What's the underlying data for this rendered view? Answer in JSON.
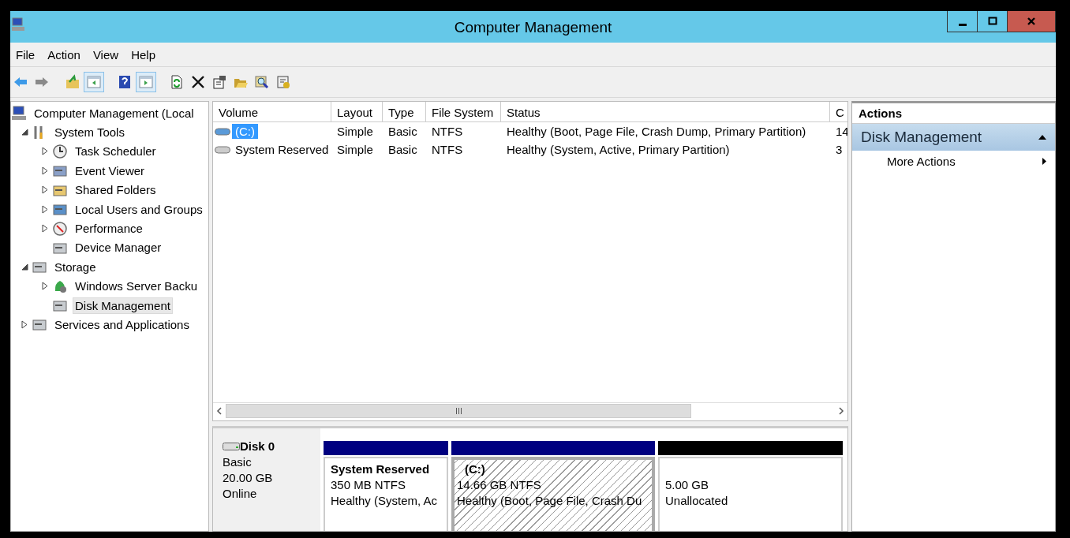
{
  "window": {
    "title": "Computer Management"
  },
  "menu": [
    "File",
    "Action",
    "View",
    "Help"
  ],
  "toolbar": [
    {
      "pressed": false
    },
    {
      "pressed": false
    },
    {
      "pressed": false
    },
    {
      "pressed": true
    },
    {
      "pressed": false
    },
    {
      "pressed": true
    },
    {
      "pressed": false
    },
    {
      "pressed": false
    },
    {
      "pressed": false
    },
    {
      "pressed": false
    },
    {
      "pressed": false
    },
    {
      "pressed": false
    }
  ],
  "tree": [
    {
      "label": "Computer Management (Local",
      "selected": false,
      "children": [
        {
          "label": "System Tools",
          "expanded": true,
          "selected": false,
          "children": [
            {
              "label": "Task Scheduler",
              "expanded": false,
              "selected": false
            },
            {
              "label": "Event Viewer",
              "expanded": false,
              "selected": false
            },
            {
              "label": "Shared Folders",
              "expanded": false,
              "selected": false
            },
            {
              "label": "Local Users and Groups",
              "expanded": false,
              "selected": false
            },
            {
              "label": "Performance",
              "expanded": false,
              "selected": false
            },
            {
              "label": "Device Manager",
              "selected": false
            }
          ]
        },
        {
          "label": "Storage",
          "expanded": true,
          "selected": false,
          "children": [
            {
              "label": "Windows Server Backu",
              "expanded": false,
              "selected": false
            },
            {
              "label": "Disk Management",
              "selected": true
            }
          ]
        },
        {
          "label": "Services and Applications",
          "expanded": false,
          "selected": false
        }
      ]
    }
  ],
  "table": {
    "columns": [
      "Volume",
      "Layout",
      "Type",
      "File System",
      "Status",
      "C"
    ],
    "rows": [
      {
        "cells": [
          "(C:)",
          "Simple",
          "Basic",
          "NTFS",
          "Healthy (Boot, Page File, Crash Dump, Primary Partition)",
          "14"
        ],
        "selected": true
      },
      {
        "cells": [
          "System Reserved",
          "Simple",
          "Basic",
          "NTFS",
          "Healthy (System, Active, Primary Partition)",
          "3"
        ],
        "selected": false
      }
    ]
  },
  "disk": {
    "name": "Disk 0",
    "type": "Basic",
    "size": "20.00 GB",
    "state": "Online",
    "partitions": [
      {
        "name": "System Reserved",
        "size": "350 MB NTFS",
        "status": "Healthy (System, Ac",
        "color": "#000080",
        "selected": false
      },
      {
        "name": "(C:)",
        "size": "14.66 GB NTFS",
        "status": "Healthy (Boot, Page File, Crash Du",
        "color": "#000080",
        "selected": true
      },
      {
        "size": "5.00 GB",
        "status": "Unallocated",
        "color": "#000000",
        "selected": false
      }
    ]
  },
  "actions": {
    "title": "Actions",
    "section": {
      "label": "Disk Management",
      "expanded": true
    },
    "items": [
      "More Actions"
    ]
  }
}
